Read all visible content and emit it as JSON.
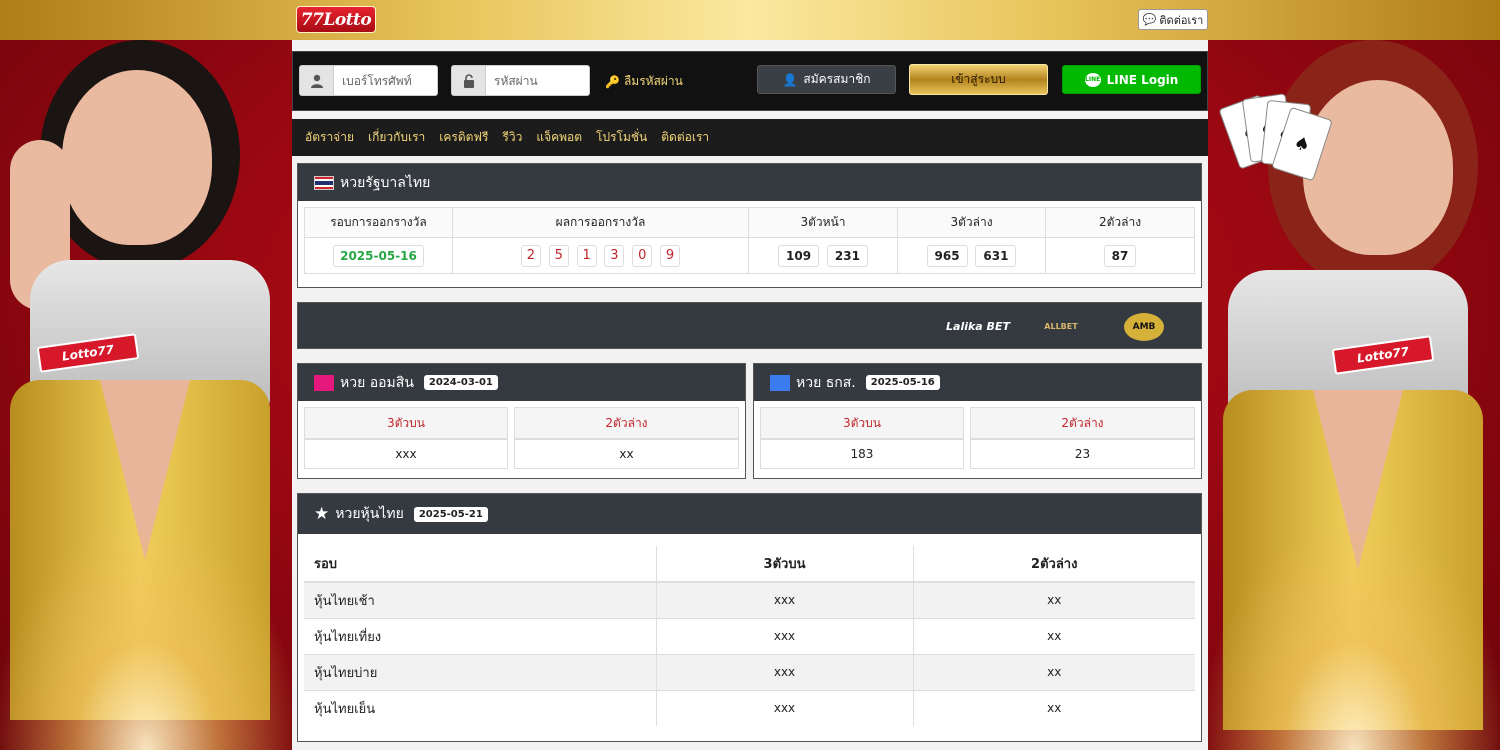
{
  "header": {
    "logo_text": "77Lotto",
    "contact_label": "ติดต่อเรา"
  },
  "login": {
    "phone_placeholder": "เบอร์โทรศัพท์",
    "password_placeholder": "รหัสผ่าน",
    "forgot_label": "ลืมรหัสผ่าน",
    "register_label": "สมัครสมาชิก",
    "login_label": "เข้าสู่ระบบ",
    "line_label": "LINE Login"
  },
  "nav": {
    "items": [
      "อัตราจ่าย",
      "เกี่ยวกับเรา",
      "เครดิตฟรี",
      "รีวิว",
      "แจ็คพอต",
      "โปรโมชั่น",
      "ติดต่อเรา"
    ]
  },
  "thai_lottery": {
    "title": "หวยรัฐบาลไทย",
    "headers": [
      "รอบการออกรางวัล",
      "ผลการออกรางวัล",
      "3ตัวหน้า",
      "3ตัวล่าง",
      "2ตัวล่าง"
    ],
    "date": "2025-05-16",
    "digits": [
      "2",
      "5",
      "1",
      "3",
      "0",
      "9"
    ],
    "front3": [
      "109",
      "231"
    ],
    "back3": [
      "965",
      "631"
    ],
    "last2": "87"
  },
  "partners": {
    "items": [
      "Lalika BET",
      "ALLBET",
      "AMB"
    ]
  },
  "gsb": {
    "title": "หวย ออมสิน",
    "date": "2024-03-01",
    "color": "#e5197d",
    "head_top3": "3ตัวบน",
    "head_bottom2": "2ตัวล่าง",
    "top3": "xxx",
    "bottom2": "xx"
  },
  "baac": {
    "title": "หวย ธกส.",
    "date": "2025-05-16",
    "color": "#3a7bf0",
    "head_top3": "3ตัวบน",
    "head_bottom2": "2ตัวล่าง",
    "top3": "183",
    "bottom2": "23"
  },
  "thai_stock": {
    "title": "หวยหุ้นไทย",
    "date": "2025-05-21",
    "headers": [
      "รอบ",
      "3ตัวบน",
      "2ตัวล่าง"
    ],
    "rows": [
      {
        "round": "หุ้นไทยเช้า",
        "top3": "xxx",
        "bottom2": "xx"
      },
      {
        "round": "หุ้นไทยเที่ยง",
        "top3": "xxx",
        "bottom2": "xx"
      },
      {
        "round": "หุ้นไทยบ่าย",
        "top3": "xxx",
        "bottom2": "xx"
      },
      {
        "round": "หุ้นไทยเย็น",
        "top3": "xxx",
        "bottom2": "xx"
      }
    ]
  },
  "side_banners": {
    "badge_text": "Lotto77"
  }
}
